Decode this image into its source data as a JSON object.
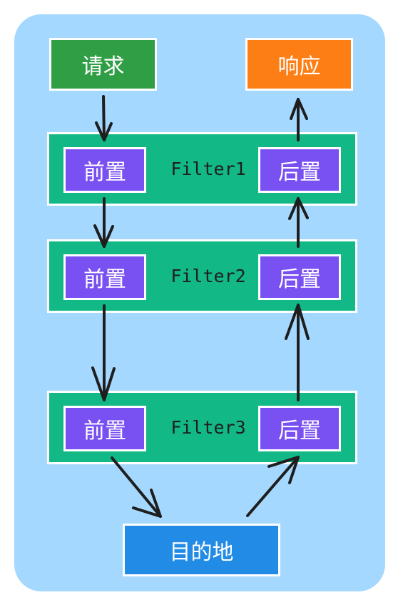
{
  "nodes": {
    "request": "请求",
    "response": "响应",
    "destination": "目的地"
  },
  "filters": [
    {
      "name": "Filter1",
      "pre": "前置",
      "post": "后置"
    },
    {
      "name": "Filter2",
      "pre": "前置",
      "post": "后置"
    },
    {
      "name": "Filter3",
      "pre": "前置",
      "post": "后置"
    }
  ],
  "colors": {
    "background_panel": "#a5d8ff",
    "request": "#2f9e44",
    "response": "#fd7e14",
    "destination": "#228be6",
    "filter": "#12b886",
    "stage": "#7950f2",
    "arrow": "#1e1e1e"
  }
}
